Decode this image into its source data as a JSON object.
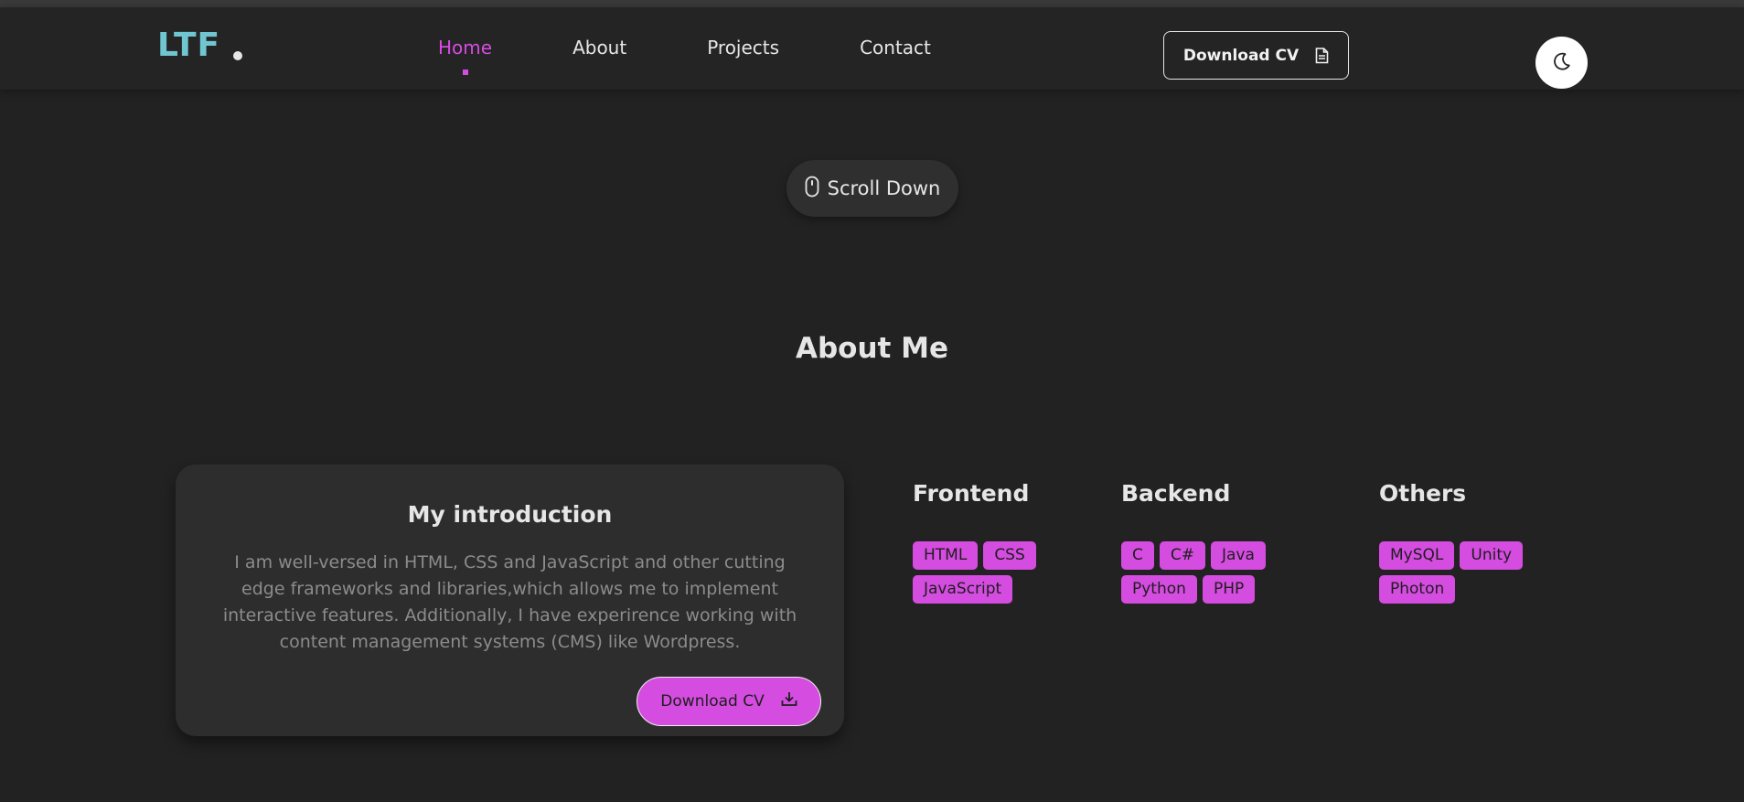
{
  "header": {
    "logo": "LTF",
    "nav": [
      {
        "label": "Home",
        "active": true
      },
      {
        "label": "About",
        "active": false
      },
      {
        "label": "Projects",
        "active": false
      },
      {
        "label": "Contact",
        "active": false
      }
    ],
    "download_cv_label": "Download CV",
    "download_cv_icon": "document-icon",
    "theme_toggle_icon": "moon-icon"
  },
  "hero": {
    "scroll_label": "Scroll Down",
    "scroll_icon": "mouse-icon"
  },
  "about": {
    "title": "About Me",
    "intro_title": "My introduction",
    "intro_text": "I am well-versed in HTML, CSS and JavaScript and other cutting edge frameworks and libraries,which allows me to implement interactive features. Additionally, I have experirence working with content management systems (CMS) like Wordpress.",
    "download_cv_label": "Download CV",
    "download_cv_icon": "download-icon"
  },
  "skills": {
    "frontend": {
      "title": "Frontend",
      "items": [
        "HTML",
        "CSS",
        "JavaScript"
      ]
    },
    "backend": {
      "title": "Backend",
      "items": [
        "C",
        "C#",
        "Java",
        "Python",
        "PHP"
      ]
    },
    "others": {
      "title": "Others",
      "items": [
        "MySQL",
        "Unity",
        "Photon"
      ]
    }
  },
  "colors": {
    "background": "#222222",
    "accent": "#d54ce0",
    "logo": "#6fc6d1",
    "card": "#2d2d2d"
  }
}
